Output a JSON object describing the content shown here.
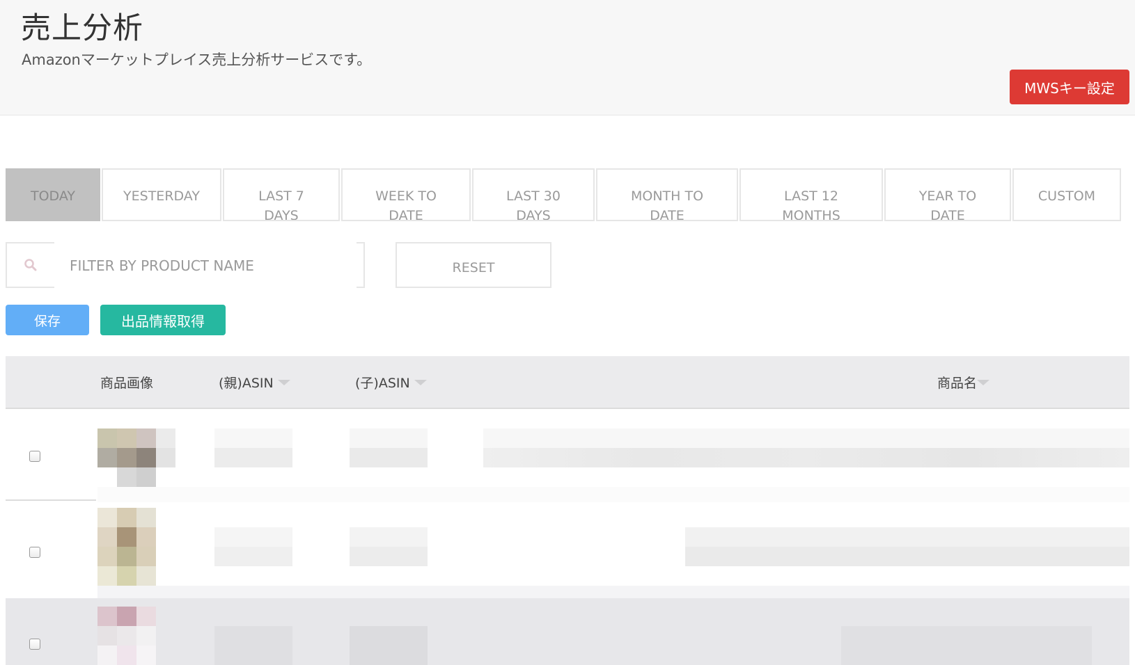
{
  "header": {
    "title": "売上分析",
    "subtitle": "Amazonマーケットプレイス売上分析サービスです。",
    "mws_button_label": "MWSキー設定"
  },
  "tabs": [
    {
      "label": "TODAY",
      "active": true
    },
    {
      "label": "YESTERDAY",
      "active": false
    },
    {
      "label": "LAST 7 DAYS",
      "active": false
    },
    {
      "label": "WEEK TO DATE",
      "active": false
    },
    {
      "label": "LAST 30 DAYS",
      "active": false
    },
    {
      "label": "MONTH TO DATE",
      "active": false
    },
    {
      "label": "LAST 12 MONTHS",
      "active": false
    },
    {
      "label": "YEAR TO DATE",
      "active": false
    },
    {
      "label": "CUSTOM",
      "active": false
    }
  ],
  "filter": {
    "placeholder": "FILTER BY PRODUCT NAME",
    "value": "",
    "reset_label": "RESET"
  },
  "actions": {
    "save_label": "保存",
    "fetch_label": "出品情報取得"
  },
  "table": {
    "columns": {
      "image": "商品画像",
      "parent_asin": "(親)ASIN",
      "child_asin": "(子)ASIN",
      "product_name": "商品名"
    }
  },
  "colors": {
    "accent_red": "#dd3a34",
    "save_blue": "#62aef7",
    "fetch_teal": "#26b8a0",
    "active_tab": "#c1c1c1"
  },
  "icons": {
    "search": "search-icon",
    "sort": "sort-caret-icon"
  }
}
